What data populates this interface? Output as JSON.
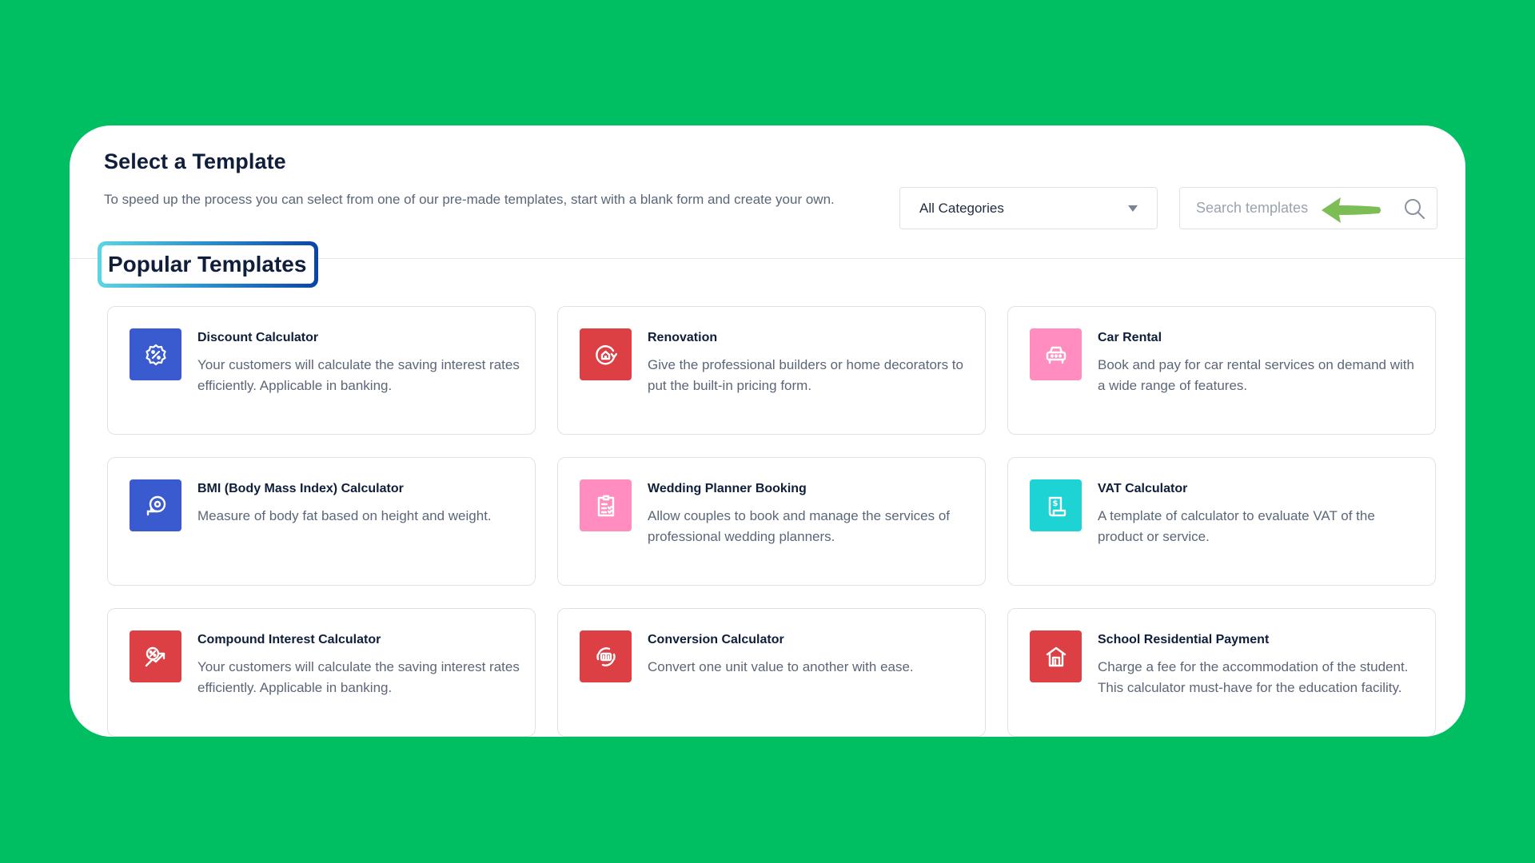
{
  "header": {
    "title": "Select a Template",
    "description": "To speed up the process you can select from one of our pre-made templates, start with a blank form and create your own."
  },
  "filters": {
    "category_selected": "All Categories",
    "search_placeholder": "Search templates",
    "search_value": ""
  },
  "section": {
    "title": "Popular Templates"
  },
  "colors": {
    "background": "#00bf63",
    "blue": "#3a5bd0",
    "red": "#dc4044",
    "pink": "#ff8dc0",
    "teal": "#1dd3d3",
    "annotation_arrow": "#7cbe55"
  },
  "templates": [
    {
      "title": "Discount Calculator",
      "description": "Your customers will calculate the saving interest rates efficiently. Applicable in banking.",
      "icon": "discount-badge-icon",
      "color": "blue"
    },
    {
      "title": "Renovation",
      "description": "Give the professional builders or home decorators to put the built-in pricing form.",
      "icon": "house-refresh-icon",
      "color": "red"
    },
    {
      "title": "Car Rental",
      "description": "Book and pay for car rental services on demand with a wide range of features.",
      "icon": "car-icon",
      "color": "pink"
    },
    {
      "title": "BMI (Body Mass Index) Calculator",
      "description": "Measure of body fat based on height and weight.",
      "icon": "measuring-tape-icon",
      "color": "blue"
    },
    {
      "title": "Wedding Planner Booking",
      "description": "Allow couples to book and manage the services of professional wedding planners.",
      "icon": "clipboard-heart-icon",
      "color": "pink"
    },
    {
      "title": "VAT Calculator",
      "description": "A template of calculator to evaluate VAT of the product or service.",
      "icon": "receipt-dollar-icon",
      "color": "teal"
    },
    {
      "title": "Compound Interest Calculator",
      "description": "Your customers will calculate the saving interest rates efficiently. Applicable in banking.",
      "icon": "interest-growth-icon",
      "color": "red"
    },
    {
      "title": "Conversion Calculator",
      "description": "Convert one unit value to another with ease.",
      "icon": "conversion-cycle-icon",
      "color": "red"
    },
    {
      "title": "School Residential Payment",
      "description": "Charge a fee for the accommodation of the student. This calculator must-have for the education facility.",
      "icon": "school-building-icon",
      "color": "red"
    }
  ]
}
